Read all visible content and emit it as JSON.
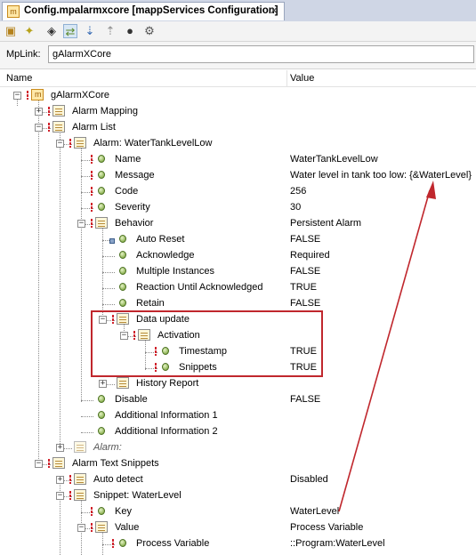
{
  "window": {
    "tab_title": "Config.mpalarmxcore [mappServices Configuration]",
    "tab_icon": "m",
    "close_glyph": "✕"
  },
  "toolbar": {
    "buttons": [
      "module-icon",
      "light-icon",
      "nav-icon",
      "sync-icon",
      "sort-desc-icon",
      "sort-asc-icon",
      "record-icon",
      "gears-icon"
    ]
  },
  "mplink": {
    "label": "MpLink:",
    "value": "gAlarmXCore"
  },
  "columns": {
    "name": "Name",
    "value": "Value"
  },
  "tree": {
    "root": {
      "label": "gAlarmXCore"
    },
    "alarm_mapping": {
      "label": "Alarm Mapping"
    },
    "alarm_list": {
      "label": "Alarm List"
    },
    "alarm": {
      "label": "Alarm: WaterTankLevelLow"
    },
    "name": {
      "label": "Name",
      "value": "WaterTankLevelLow"
    },
    "message": {
      "label": "Message",
      "value": "Water level in tank too low: {&WaterLevel}"
    },
    "code": {
      "label": "Code",
      "value": "256"
    },
    "severity": {
      "label": "Severity",
      "value": "30"
    },
    "behavior": {
      "label": "Behavior",
      "value": "Persistent Alarm"
    },
    "auto_reset": {
      "label": "Auto Reset",
      "value": "FALSE"
    },
    "acknowledge": {
      "label": "Acknowledge",
      "value": "Required"
    },
    "multiple_instances": {
      "label": "Multiple Instances",
      "value": "FALSE"
    },
    "reaction_until_ack": {
      "label": "Reaction Until Acknowledged",
      "value": "TRUE"
    },
    "retain": {
      "label": "Retain",
      "value": "FALSE"
    },
    "data_update": {
      "label": "Data update"
    },
    "activation": {
      "label": "Activation"
    },
    "timestamp": {
      "label": "Timestamp",
      "value": "TRUE"
    },
    "snippets": {
      "label": "Snippets",
      "value": "TRUE"
    },
    "history_report": {
      "label": "History Report"
    },
    "disable": {
      "label": "Disable",
      "value": "FALSE"
    },
    "additional_info_1": {
      "label": "Additional Information 1"
    },
    "additional_info_2": {
      "label": "Additional Information 2"
    },
    "alarm_placeholder": {
      "label": "Alarm:"
    },
    "alarm_text_snippets": {
      "label": "Alarm Text Snippets"
    },
    "auto_detect": {
      "label": "Auto detect",
      "value": "Disabled"
    },
    "snippet": {
      "label": "Snippet: WaterLevel"
    },
    "key": {
      "label": "Key",
      "value": "WaterLevel"
    },
    "value_node": {
      "label": "Value",
      "value": "Process Variable"
    },
    "process_variable": {
      "label": "Process Variable",
      "value": "::Program:WaterLevel"
    }
  },
  "colors": {
    "highlight_box": "#c0272d",
    "arrow": "#c0272d",
    "required_marker": "#d0202a"
  }
}
